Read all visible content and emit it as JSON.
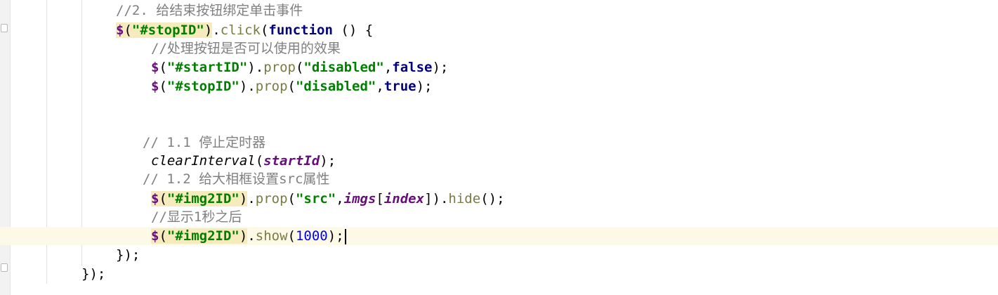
{
  "code": {
    "l1": {
      "comment": "//2. 给结束按钮绑定单击事件"
    },
    "l2": {
      "dollar": "$",
      "paren_open": "(",
      "selector": "\"#stopID\"",
      "paren_close": ")",
      "dot": ".",
      "method": "click",
      "open": "(",
      "keyword": "function",
      "rest": " () {"
    },
    "l3": {
      "comment": "//处理按钮是否可以使用的效果"
    },
    "l4": {
      "dollar": "$",
      "open": "(",
      "selector": "\"#startID\"",
      "close": ")",
      "dot": ".",
      "method": "prop",
      "open2": "(",
      "arg1": "\"disabled\"",
      "comma": ",",
      "arg2": "false",
      "end": ");"
    },
    "l5": {
      "dollar": "$",
      "open": "(",
      "selector": "\"#stopID\"",
      "close": ")",
      "dot": ".",
      "method": "prop",
      "open2": "(",
      "arg1": "\"disabled\"",
      "comma": ",",
      "arg2": "true",
      "end": ");"
    },
    "l8": {
      "comment": "// 1.1 停止定时器"
    },
    "l9": {
      "func": "clearInterval",
      "open": "(",
      "arg": "startId",
      "end": ");"
    },
    "l10": {
      "comment": "// 1.2 给大相框设置src属性"
    },
    "l11": {
      "dollar": "$",
      "open": "(",
      "selector": "\"#img2ID\"",
      "close": ")",
      "dot": ".",
      "method": "prop",
      "open2": "(",
      "arg1": "\"src\"",
      "comma": ",",
      "arr": "imgs",
      "bracket_open": "[",
      "idx": "index",
      "bracket_close": "]",
      "close2": ")",
      "dot2": ".",
      "method2": "hide",
      "end": "();"
    },
    "l12": {
      "comment": "//显示1秒之后"
    },
    "l13": {
      "dollar": "$",
      "open": "(",
      "selector": "\"#img2ID\"",
      "close": ")",
      "dot": ".",
      "method": "show",
      "open2": "(",
      "num": "1000",
      "end": ");"
    },
    "l14": {
      "text": "});"
    },
    "l15": {
      "text": "});"
    }
  },
  "colors": {
    "comment": "#808080",
    "keyword": "#000080",
    "string": "#008000",
    "number": "#0000ff",
    "variable": "#660e7a",
    "method": "#7a7a43",
    "current_line": "#fdf9e7",
    "match_highlight": "#f6ebbc"
  }
}
